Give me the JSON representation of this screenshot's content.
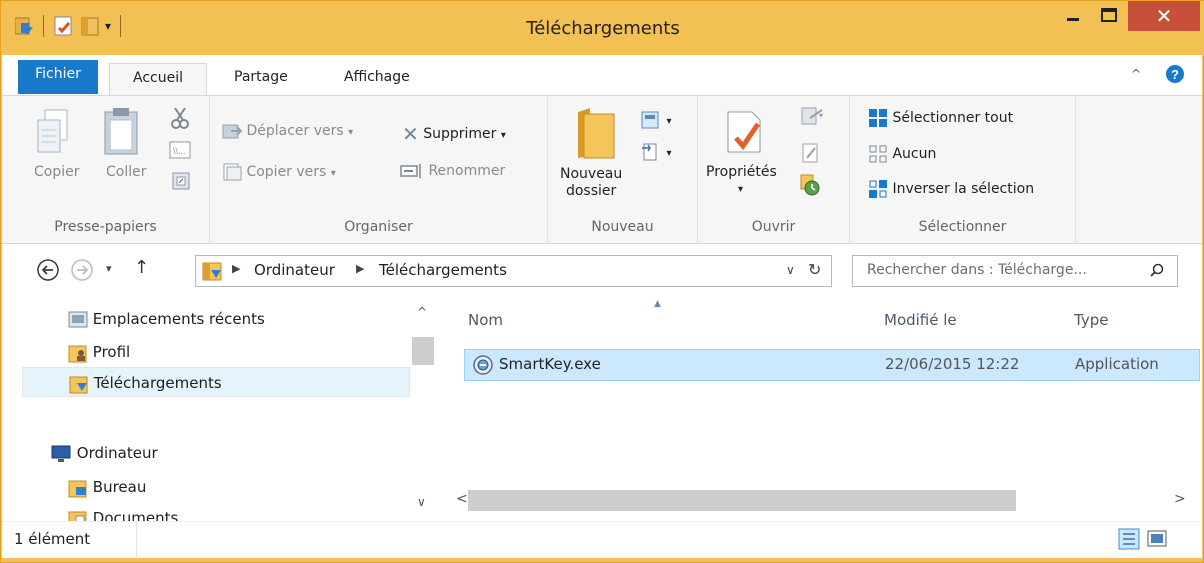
{
  "window": {
    "title": "Téléchargements",
    "close_glyph": "✕"
  },
  "ribbon_tabs": [
    "Fichier",
    "Accueil",
    "Partage",
    "Affichage"
  ],
  "ribbon": {
    "presse_papiers": {
      "label": "Presse-papiers",
      "copy": "Copier",
      "paste": "Coller"
    },
    "organiser": {
      "label": "Organiser",
      "move": "Déplacer vers",
      "copy_to": "Copier vers",
      "delete": "Supprimer",
      "rename": "Renommer"
    },
    "nouveau": {
      "label": "Nouveau",
      "new_folder_1": "Nouveau",
      "new_folder_2": "dossier"
    },
    "ouvrir": {
      "label": "Ouvrir",
      "properties": "Propriétés"
    },
    "selectionner": {
      "label": "Sélectionner",
      "select_all": "Sélectionner tout",
      "none": "Aucun",
      "invert": "Inverser la sélection"
    }
  },
  "address": {
    "crumbs": [
      "Ordinateur",
      "Téléchargements"
    ],
    "search_placeholder": "Rechercher dans : Télécharge..."
  },
  "nav_pane": {
    "recent": "Emplacements récents",
    "profile": "Profil",
    "downloads": "Téléchargements",
    "computer": "Ordinateur",
    "desktop": "Bureau",
    "documents": "Documents"
  },
  "columns": {
    "name": "Nom",
    "modified": "Modifié le",
    "type": "Type"
  },
  "files": [
    {
      "name": "SmartKey.exe",
      "modified": "22/06/2015 12:22",
      "type": "Application"
    }
  ],
  "status": {
    "count": "1 élément"
  },
  "colors": {
    "titlebar": "#f2c053",
    "file_tab": "#1979ca",
    "selection": "#cce8ff",
    "close": "#c7503a"
  }
}
